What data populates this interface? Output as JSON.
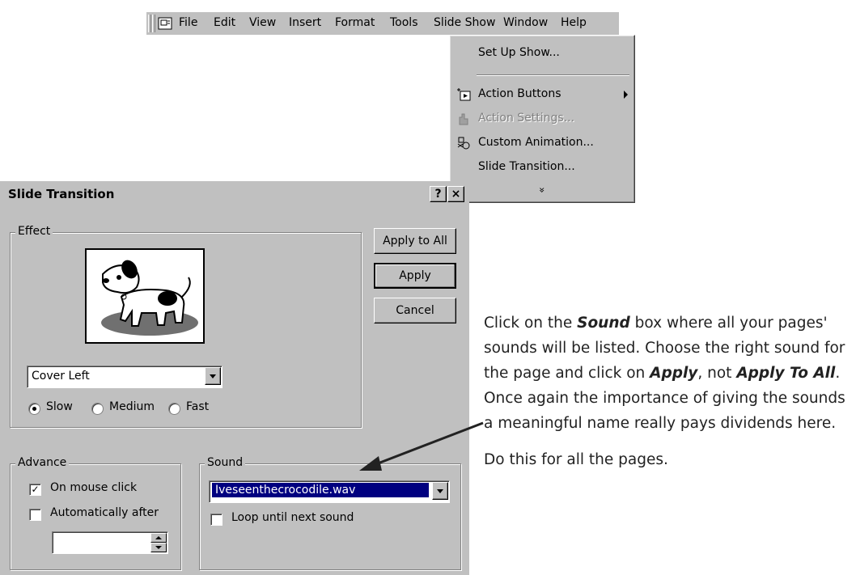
{
  "menubar": {
    "items": [
      "File",
      "Edit",
      "View",
      "Insert",
      "Format",
      "Tools",
      "Slide Show",
      "Window",
      "Help"
    ]
  },
  "dropdown": {
    "setup_show": "Set Up Show...",
    "action_buttons": "Action Buttons",
    "action_settings": "Action Settings...",
    "custom_animation": "Custom Animation...",
    "slide_transition": "Slide Transition...",
    "expand": "»"
  },
  "dialog": {
    "title": "Slide Transition",
    "help_button": "?",
    "close_button": "×",
    "effect": {
      "legend": "Effect",
      "selected_effect": "Cover Left",
      "speed_options": [
        "Slow",
        "Medium",
        "Fast"
      ],
      "selected_speed": "Slow"
    },
    "buttons": {
      "apply_to_all": "Apply to All",
      "apply": "Apply",
      "cancel": "Cancel"
    },
    "advance": {
      "legend": "Advance",
      "on_mouse_click": "On mouse click",
      "on_mouse_click_checked": true,
      "automatically_after": "Automatically after",
      "automatically_after_checked": false,
      "automatically_after_value": ""
    },
    "sound": {
      "legend": "Sound",
      "selected": "Iveseenthecrocodile.wav",
      "loop_label": "Loop until next sound",
      "loop_checked": false
    }
  },
  "annotation": {
    "p1_a": "Click on the ",
    "p1_sound": "Sound",
    "p1_b": " box where all your pages' sounds will be listed. Choose the right sound for the page and click on ",
    "p1_apply": "Apply",
    "p1_c": ", not ",
    "p1_apply_all": "Apply To All",
    "p1_d": ". Once again the importance of giving the sounds a meaningful name really pays dividends here.",
    "p2": "Do this for all the pages."
  }
}
